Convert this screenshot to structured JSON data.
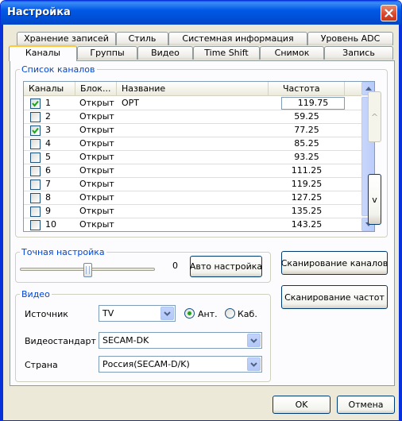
{
  "window": {
    "title": "Настройка"
  },
  "tabs_row1": [
    "Хранение записей",
    "Стиль",
    "Системная информация",
    "Уровень ADC"
  ],
  "tabs_row2": [
    "Каналы",
    "Группы",
    "Видео",
    "Time Shift",
    "Снимок",
    "Запись"
  ],
  "active_tab": "Каналы",
  "channels": {
    "group_label": "Список каналов",
    "columns": [
      "Каналы",
      "Блок...",
      "Название",
      "Частота"
    ],
    "rows": [
      {
        "num": "1",
        "checked": true,
        "block": "Открыт",
        "name": "ОРТ",
        "freq": "119.75",
        "editing": true
      },
      {
        "num": "2",
        "checked": false,
        "block": "Открыт",
        "name": "",
        "freq": "59.25"
      },
      {
        "num": "3",
        "checked": true,
        "block": "Открыт",
        "name": "",
        "freq": "77.25"
      },
      {
        "num": "4",
        "checked": false,
        "block": "Открыт",
        "name": "",
        "freq": "85.25"
      },
      {
        "num": "5",
        "checked": false,
        "block": "Открыт",
        "name": "",
        "freq": "93.25"
      },
      {
        "num": "6",
        "checked": false,
        "block": "Открыт",
        "name": "",
        "freq": "111.25"
      },
      {
        "num": "7",
        "checked": false,
        "block": "Открыт",
        "name": "",
        "freq": "119.25"
      },
      {
        "num": "8",
        "checked": false,
        "block": "Открыт",
        "name": "",
        "freq": "127.25"
      },
      {
        "num": "9",
        "checked": false,
        "block": "Открыт",
        "name": "",
        "freq": "135.25"
      },
      {
        "num": "10",
        "checked": false,
        "block": "Открыт",
        "name": "",
        "freq": "143.25"
      }
    ],
    "move_up_label": "^",
    "move_down_label": "v"
  },
  "fine_tune": {
    "group_label": "Точная настройка",
    "value": "0",
    "slider_level": 0.5,
    "auto_button": "Авто настройка"
  },
  "scan": {
    "channels_button": "Сканирование каналов",
    "freq_button": "Сканирование частот"
  },
  "video": {
    "group_label": "Видео",
    "source_label": "Источник",
    "source_value": "TV",
    "antenna_label": "Ант.",
    "cable_label": "Каб.",
    "antenna_selected": true,
    "standard_label": "Видеостандарт",
    "standard_value": "SECAM-DK",
    "country_label": "Страна",
    "country_value": "Россия(SECAM-D/K)"
  },
  "footer": {
    "ok": "OK",
    "cancel": "Отмена"
  },
  "colors": {
    "title_bar": "#0058e6",
    "group_title": "#0046d5",
    "check": "#21a121"
  }
}
